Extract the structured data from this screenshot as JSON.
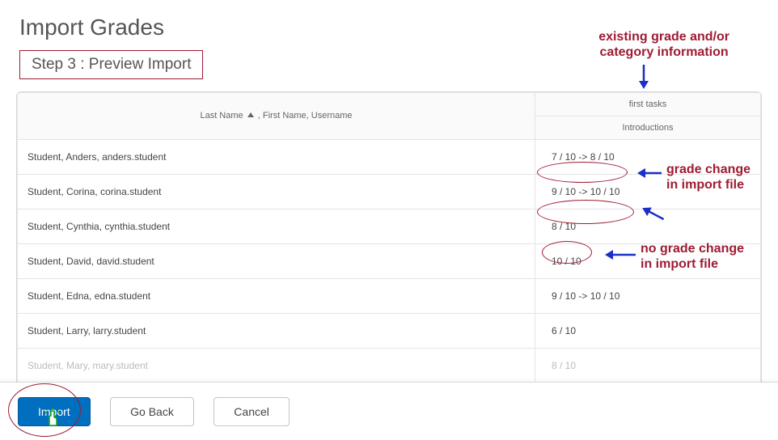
{
  "page": {
    "title": "Import Grades",
    "step_label": "Step 3 : Preview Import"
  },
  "annotations": {
    "top_line1": "existing grade and/or",
    "top_line2": "category information",
    "change_line1": "grade change",
    "change_line2": "in import file",
    "no_change_line1": "no grade change",
    "no_change_line2": "in import file"
  },
  "table": {
    "header": {
      "name_col_prefix": "Last Name",
      "name_col_rest": ", First Name, Username",
      "category": "first tasks",
      "item": "Introductions"
    },
    "rows": [
      {
        "name": "Student, Anders, anders.student",
        "grade": "7 / 10 -> 8 / 10"
      },
      {
        "name": "Student, Corina, corina.student",
        "grade": "9 / 10 -> 10 / 10"
      },
      {
        "name": "Student, Cynthia, cynthia.student",
        "grade": "8 / 10"
      },
      {
        "name": "Student, David, david.student",
        "grade": "10 / 10"
      },
      {
        "name": "Student, Edna, edna.student",
        "grade": "9 / 10 -> 10 / 10"
      },
      {
        "name": "Student, Larry, larry.student",
        "grade": "6 / 10"
      },
      {
        "name": "Student, Mary, mary.student",
        "grade": "8 / 10"
      }
    ]
  },
  "buttons": {
    "import": "Import",
    "go_back": "Go Back",
    "cancel": "Cancel"
  }
}
